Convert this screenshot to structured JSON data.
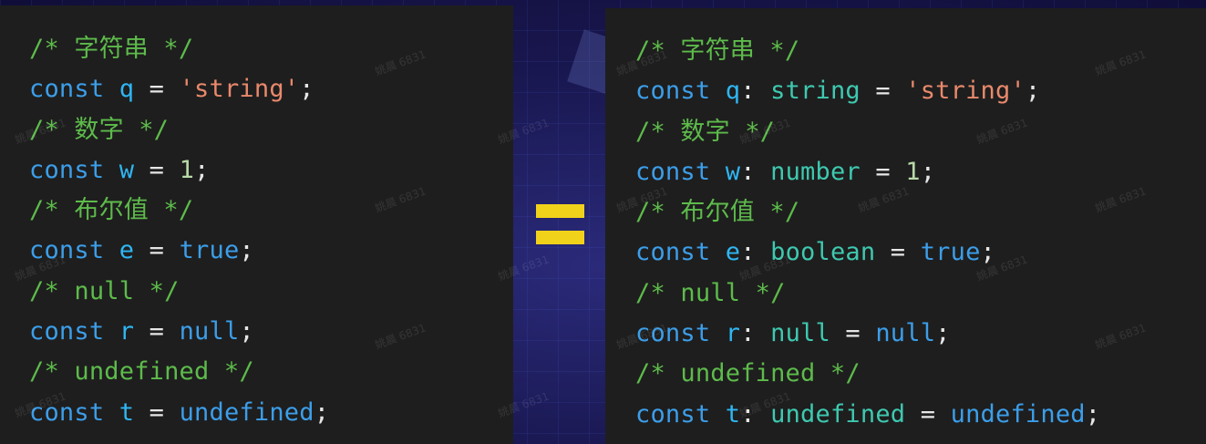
{
  "left_panel": {
    "lines": [
      [
        {
          "t": "/* 字符串 */",
          "c": "cm"
        }
      ],
      [
        {
          "t": "const",
          "c": "kw"
        },
        {
          "t": " ",
          "c": "op"
        },
        {
          "t": "q",
          "c": "vr"
        },
        {
          "t": " = ",
          "c": "op"
        },
        {
          "t": "'string'",
          "c": "st"
        },
        {
          "t": ";",
          "c": "op"
        }
      ],
      [
        {
          "t": "/* 数字 */",
          "c": "cm"
        }
      ],
      [
        {
          "t": "const",
          "c": "kw"
        },
        {
          "t": " ",
          "c": "op"
        },
        {
          "t": "w",
          "c": "vr"
        },
        {
          "t": " = ",
          "c": "op"
        },
        {
          "t": "1",
          "c": "nm"
        },
        {
          "t": ";",
          "c": "op"
        }
      ],
      [
        {
          "t": "/* 布尔值 */",
          "c": "cm"
        }
      ],
      [
        {
          "t": "const",
          "c": "kw"
        },
        {
          "t": " ",
          "c": "op"
        },
        {
          "t": "e",
          "c": "vr"
        },
        {
          "t": " = ",
          "c": "op"
        },
        {
          "t": "true",
          "c": "kw"
        },
        {
          "t": ";",
          "c": "op"
        }
      ],
      [
        {
          "t": "/* null */",
          "c": "cm"
        }
      ],
      [
        {
          "t": "const",
          "c": "kw"
        },
        {
          "t": " ",
          "c": "op"
        },
        {
          "t": "r",
          "c": "vr"
        },
        {
          "t": " = ",
          "c": "op"
        },
        {
          "t": "null",
          "c": "kw"
        },
        {
          "t": ";",
          "c": "op"
        }
      ],
      [
        {
          "t": "/* undefined */",
          "c": "cm"
        }
      ],
      [
        {
          "t": "const",
          "c": "kw"
        },
        {
          "t": " ",
          "c": "op"
        },
        {
          "t": "t",
          "c": "vr"
        },
        {
          "t": " = ",
          "c": "op"
        },
        {
          "t": "undefined",
          "c": "kw"
        },
        {
          "t": ";",
          "c": "op"
        }
      ]
    ]
  },
  "right_panel": {
    "lines": [
      [
        {
          "t": "/* 字符串 */",
          "c": "cm"
        }
      ],
      [
        {
          "t": "const",
          "c": "kw"
        },
        {
          "t": " ",
          "c": "op"
        },
        {
          "t": "q",
          "c": "vr"
        },
        {
          "t": ": ",
          "c": "op"
        },
        {
          "t": "string",
          "c": "ty"
        },
        {
          "t": " = ",
          "c": "op"
        },
        {
          "t": "'string'",
          "c": "st"
        },
        {
          "t": ";",
          "c": "op"
        }
      ],
      [
        {
          "t": "/* 数字 */",
          "c": "cm"
        }
      ],
      [
        {
          "t": "const",
          "c": "kw"
        },
        {
          "t": " ",
          "c": "op"
        },
        {
          "t": "w",
          "c": "vr"
        },
        {
          "t": ": ",
          "c": "op"
        },
        {
          "t": "number",
          "c": "ty"
        },
        {
          "t": " = ",
          "c": "op"
        },
        {
          "t": "1",
          "c": "nm"
        },
        {
          "t": ";",
          "c": "op"
        }
      ],
      [
        {
          "t": "/* 布尔值 */",
          "c": "cm"
        }
      ],
      [
        {
          "t": "const",
          "c": "kw"
        },
        {
          "t": " ",
          "c": "op"
        },
        {
          "t": "e",
          "c": "vr"
        },
        {
          "t": ": ",
          "c": "op"
        },
        {
          "t": "boolean",
          "c": "ty"
        },
        {
          "t": " = ",
          "c": "op"
        },
        {
          "t": "true",
          "c": "kw"
        },
        {
          "t": ";",
          "c": "op"
        }
      ],
      [
        {
          "t": "/* null */",
          "c": "cm"
        }
      ],
      [
        {
          "t": "const",
          "c": "kw"
        },
        {
          "t": " ",
          "c": "op"
        },
        {
          "t": "r",
          "c": "vr"
        },
        {
          "t": ": ",
          "c": "op"
        },
        {
          "t": "null",
          "c": "ty"
        },
        {
          "t": " = ",
          "c": "op"
        },
        {
          "t": "null",
          "c": "kw"
        },
        {
          "t": ";",
          "c": "op"
        }
      ],
      [
        {
          "t": "/* undefined */",
          "c": "cm"
        }
      ],
      [
        {
          "t": "const",
          "c": "kw"
        },
        {
          "t": " ",
          "c": "op"
        },
        {
          "t": "t",
          "c": "vr"
        },
        {
          "t": ": ",
          "c": "op"
        },
        {
          "t": "undefined",
          "c": "ty"
        },
        {
          "t": " = ",
          "c": "op"
        },
        {
          "t": "undefined",
          "c": "kw"
        },
        {
          "t": ";",
          "c": "op"
        }
      ]
    ]
  },
  "equals_sign": {
    "icon": "equals-icon",
    "color": "#f1d21a"
  },
  "watermark": "姚晨 6831",
  "colors": {
    "comment": "#5dbb4b",
    "keyword": "#3c9ee9",
    "variable": "#2fb6f3",
    "string": "#e9896c",
    "number": "#b7d9a7",
    "type": "#3ec9b0",
    "panel_bg": "#1e1e1e"
  }
}
